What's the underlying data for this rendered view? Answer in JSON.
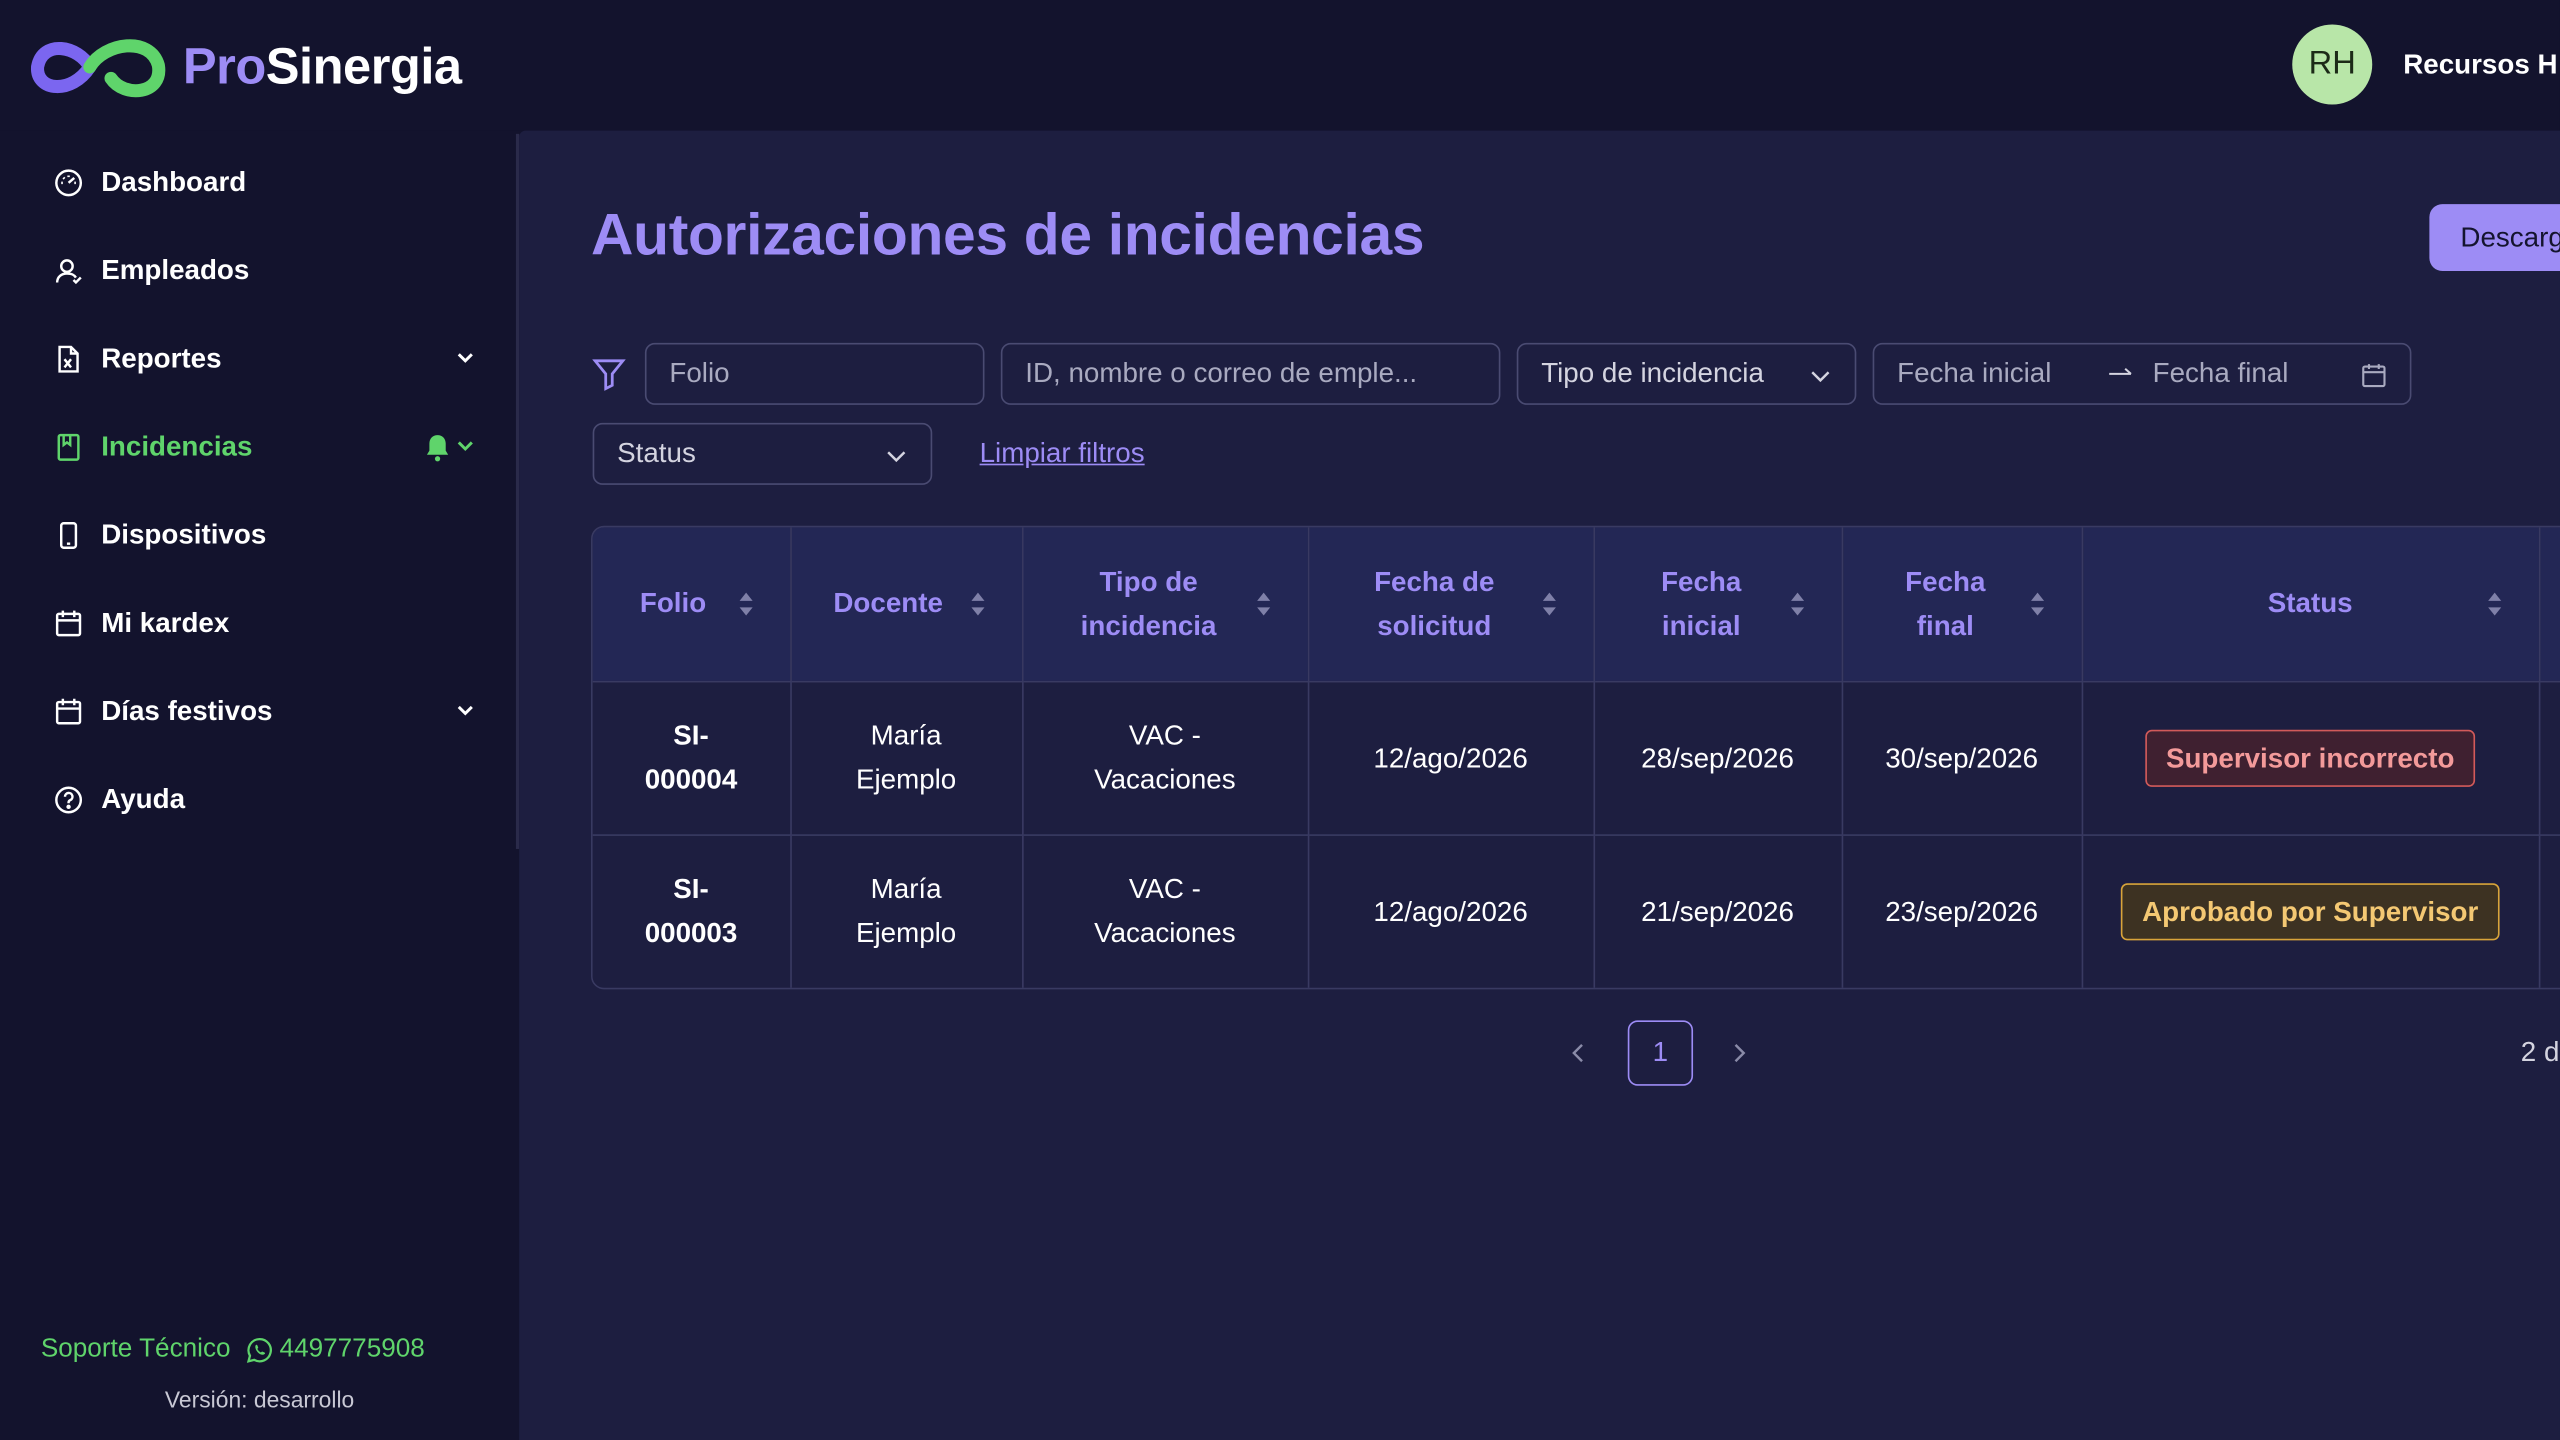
{
  "brand": {
    "prefix": "Pro",
    "name": "Sinergia"
  },
  "user": {
    "initials": "RH",
    "name": "Recursos H"
  },
  "sidebar": {
    "items": [
      {
        "label": "Dashboard",
        "icon": "gauge-icon"
      },
      {
        "label": "Empleados",
        "icon": "user-icon"
      },
      {
        "label": "Reportes",
        "icon": "report-file-icon"
      },
      {
        "label": "Incidencias",
        "icon": "bookmark-icon"
      },
      {
        "label": "Dispositivos",
        "icon": "mobile-icon"
      },
      {
        "label": "Mi kardex",
        "icon": "calendar-icon"
      },
      {
        "label": "Días festivos",
        "icon": "calendar-icon"
      },
      {
        "label": "Ayuda",
        "icon": "help-circle-icon"
      }
    ],
    "active": "Incidencias",
    "support_label": "Soporte Técnico",
    "support_phone": "4497775908",
    "version": "Versión: desarrollo"
  },
  "main": {
    "title": "Autorizaciones de incidencias",
    "download_label": "Descarg"
  },
  "filters": {
    "folio_placeholder": "Folio",
    "employee_placeholder": "ID, nombre o correo de emple...",
    "tipo_value": "Tipo de incidencia",
    "fecha_inicial_placeholder": "Fecha inicial",
    "fecha_final_placeholder": "Fecha final",
    "status_value": "Status",
    "clear_label": "Limpiar filtros"
  },
  "table": {
    "headers": [
      {
        "line1": "Folio",
        "line2": ""
      },
      {
        "line1": "Docente",
        "line2": ""
      },
      {
        "line1": "Tipo de",
        "line2": "incidencia"
      },
      {
        "line1": "Fecha de",
        "line2": "solicitud"
      },
      {
        "line1": "Fecha",
        "line2": "inicial"
      },
      {
        "line1": "Fecha",
        "line2": "final"
      },
      {
        "line1": "Status",
        "line2": ""
      }
    ],
    "rows": [
      {
        "folio_a": "SI-",
        "folio_b": "000004",
        "docente_a": "María",
        "docente_b": "Ejemplo",
        "tipo_a": "VAC -",
        "tipo_b": "Vacaciones",
        "solicitud": "12/ago/2026",
        "inicial": "28/sep/2026",
        "final": "30/sep/2026",
        "status": "Supervisor incorrecto"
      },
      {
        "folio_a": "SI-",
        "folio_b": "000003",
        "docente_a": "María",
        "docente_b": "Ejemplo",
        "tipo_a": "VAC -",
        "tipo_b": "Vacaciones",
        "solicitud": "12/ago/2026",
        "inicial": "21/sep/2026",
        "final": "23/sep/2026",
        "status": "Aprobado por Supervisor"
      }
    ]
  },
  "pagination": {
    "current": "1",
    "total_text": "2 d"
  },
  "colors": {
    "accent": "#9d8cf5",
    "active_green": "#5fd46b",
    "background": "#13132d",
    "panel": "#1d1e40"
  }
}
